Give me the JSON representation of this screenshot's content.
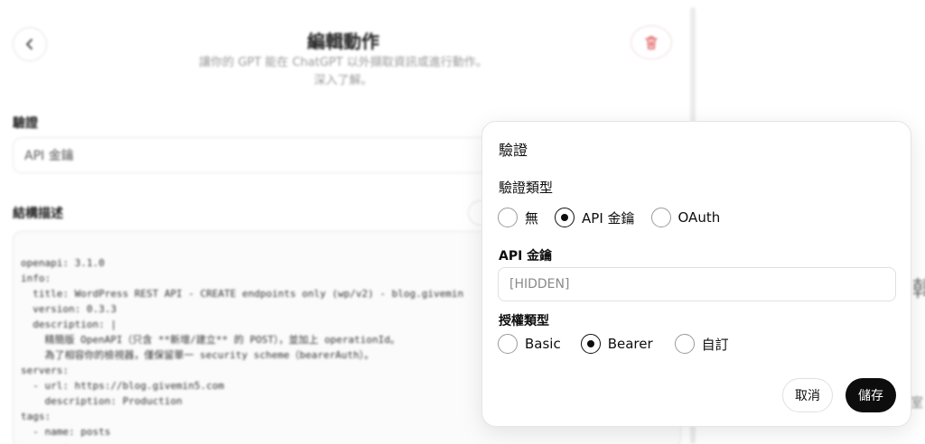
{
  "editor": {
    "title": "編輯動作",
    "subtitle_line1": "讓你的 GPT 能在 ChatGPT 以外擷取資訊或進行動作。",
    "subtitle_line2": "深入了解。",
    "auth_label": "驗證",
    "auth_value": "API 金鑰",
    "schema_label": "結構描述",
    "schema_lines": [
      "openapi: 3.1.0",
      "info:",
      "  title: WordPress REST API - CREATE endpoints only (wp/v2) - blog.givemin",
      "  version: 0.3.3",
      "  description: |",
      "    精簡版 OpenAPI（只含 **新增/建立** 的 POST），並加上 operationId。",
      "    為了相容你的檢視器，僅保留單一 security scheme（bearerAuth）。",
      "servers:",
      "  - url: https://blog.givemin5.com",
      "    description: Production",
      "tags:",
      "  - name: posts",
      "    ...: ....."
    ],
    "right_glyph": "韓",
    "right_glyph2": "室"
  },
  "modal": {
    "title": "驗證",
    "auth_type_label": "驗證類型",
    "auth_types": [
      {
        "label": "無",
        "checked": false
      },
      {
        "label": "API 金鑰",
        "checked": true
      },
      {
        "label": "OAuth",
        "checked": false
      }
    ],
    "api_key_label": "API 金鑰",
    "api_key_value": "[HIDDEN]",
    "grant_type_label": "授權類型",
    "grant_types": [
      {
        "label": "Basic",
        "checked": false
      },
      {
        "label": "Bearer",
        "checked": true
      },
      {
        "label": "自訂",
        "checked": false
      }
    ],
    "cancel_label": "取消",
    "save_label": "儲存"
  }
}
